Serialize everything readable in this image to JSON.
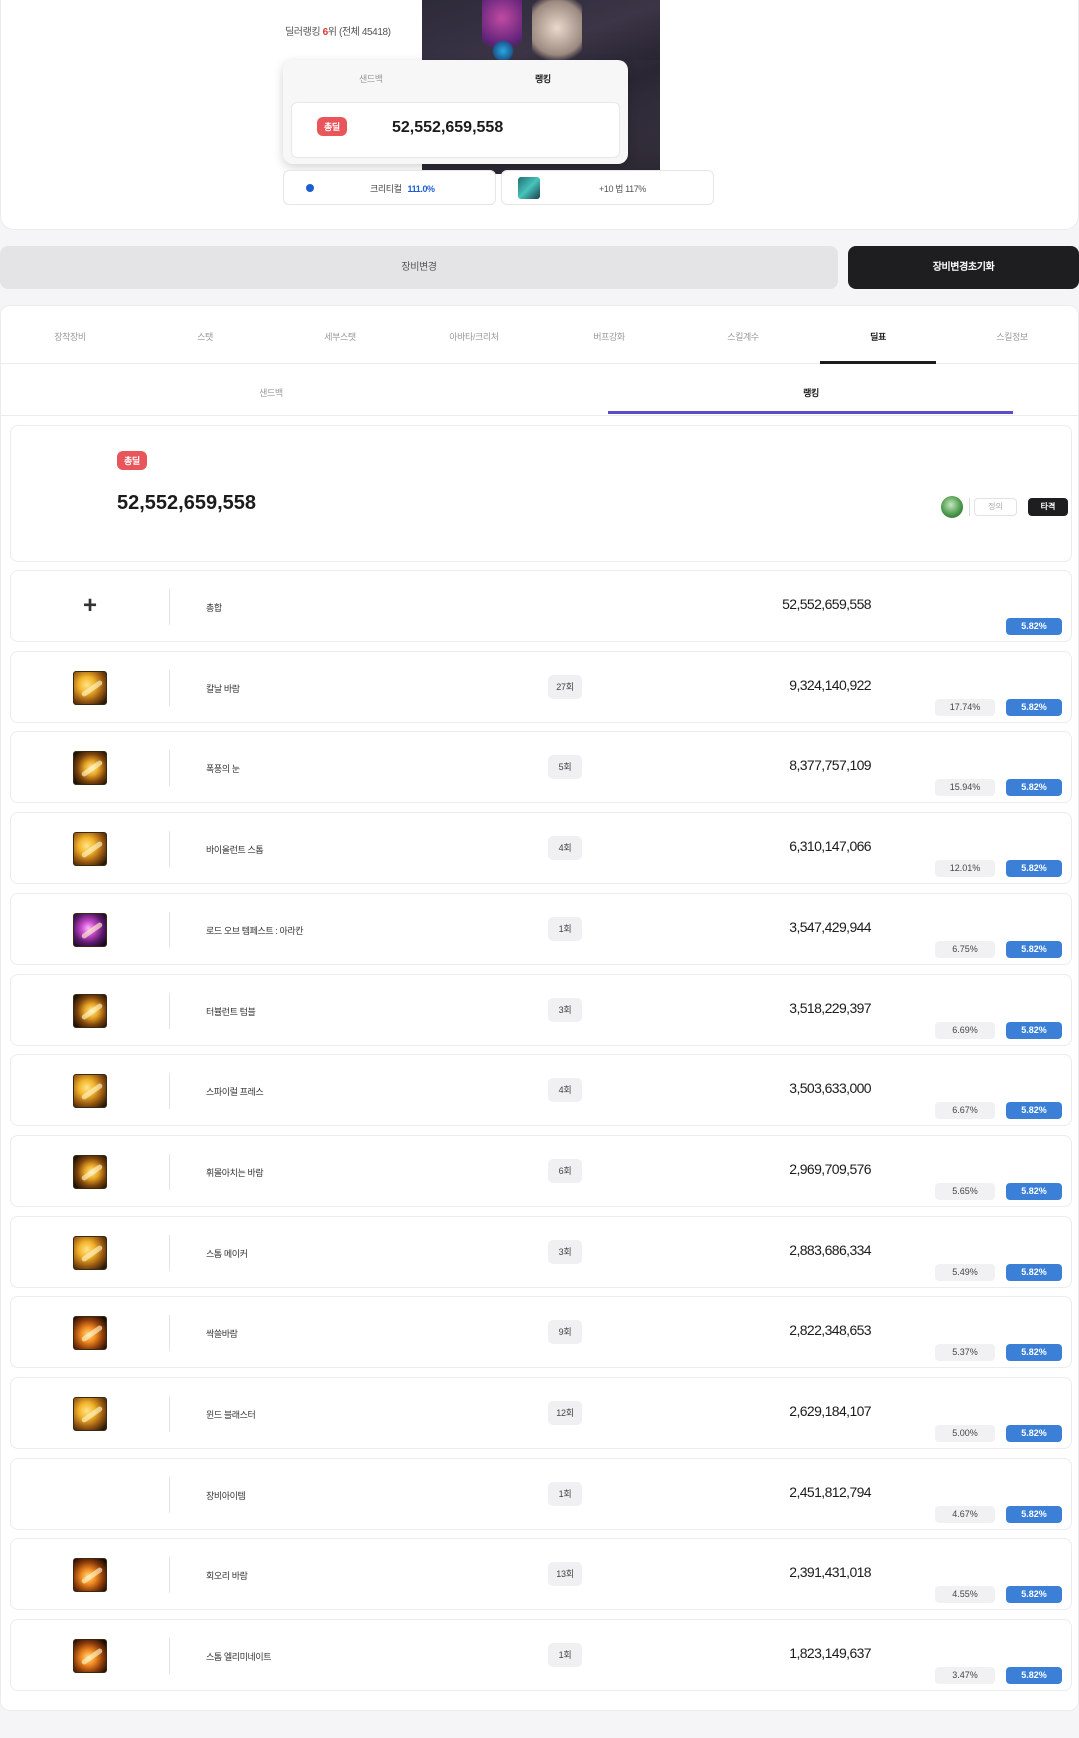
{
  "profile": {
    "dealer_rank_prefix": "딜러랭킹",
    "dealer_rank_num": "6",
    "dealer_rank_suffix": "위 (전체 45418)",
    "panel_tabs": [
      "샌드백",
      "랭킹"
    ],
    "total_badge": "총딜",
    "total_damage": "52,552,659,558"
  },
  "stats": {
    "crit_label": "크리티컬",
    "crit_value": "111.0%",
    "item_label": "+10 법 117%"
  },
  "actions": {
    "change_label": "장비변경",
    "reset_label": "장비변경초기화"
  },
  "main_tabs": [
    "장착장비",
    "스탯",
    "세부스탯",
    "아바타/크리처",
    "버프강화",
    "스킬계수",
    "딜표",
    "스킬정보"
  ],
  "sub_tabs": [
    "샌드백",
    "랭킹"
  ],
  "summary": {
    "badge": "총딜",
    "total": "52,552,659,558",
    "hold_label": "정의",
    "hit_label": "타격"
  },
  "rows": [
    {
      "icon": "plus-icon",
      "name": "총합",
      "hits": "",
      "damage": "52,552,659,558",
      "pct": "",
      "pct_blue": "5.82%"
    },
    {
      "icon": "blade-wind-skill-icon",
      "name": "칼날 바람",
      "hits": "27회",
      "damage": "9,324,140,922",
      "pct": "17.74%",
      "pct_blue": "5.82%"
    },
    {
      "icon": "storm-eye-skill-icon",
      "name": "폭풍의 눈",
      "hits": "5회",
      "damage": "8,377,757,109",
      "pct": "15.94%",
      "pct_blue": "5.82%"
    },
    {
      "icon": "violent-storm-skill-icon",
      "name": "바이올런트 스톰",
      "hits": "4회",
      "damage": "6,310,147,066",
      "pct": "12.01%",
      "pct_blue": "5.82%"
    },
    {
      "icon": "lord-of-tempest-skill-icon",
      "name": "로드 오브 템페스트 : 아라칸",
      "hits": "1회",
      "damage": "3,547,429,944",
      "pct": "6.75%",
      "pct_blue": "5.82%"
    },
    {
      "icon": "turbulent-tumble-skill-icon",
      "name": "터뷸런트 텀블",
      "hits": "3회",
      "damage": "3,518,229,397",
      "pct": "6.69%",
      "pct_blue": "5.82%"
    },
    {
      "icon": "spiral-press-skill-icon",
      "name": "스파이럴 프레스",
      "hits": "4회",
      "damage": "3,503,633,000",
      "pct": "6.67%",
      "pct_blue": "5.82%"
    },
    {
      "icon": "sweeping-wind-skill-icon",
      "name": "휘몰아치는 바람",
      "hits": "6회",
      "damage": "2,969,709,576",
      "pct": "5.65%",
      "pct_blue": "5.82%"
    },
    {
      "icon": "storm-maker-skill-icon",
      "name": "스톰 메이커",
      "hits": "3회",
      "damage": "2,883,686,334",
      "pct": "5.49%",
      "pct_blue": "5.82%"
    },
    {
      "icon": "cold-wind-skill-icon",
      "name": "싹쓸바람",
      "hits": "9회",
      "damage": "2,822,348,653",
      "pct": "5.37%",
      "pct_blue": "5.82%"
    },
    {
      "icon": "wind-blaster-skill-icon",
      "name": "윈드 블래스터",
      "hits": "12회",
      "damage": "2,629,184,107",
      "pct": "5.00%",
      "pct_blue": "5.82%"
    },
    {
      "icon": "",
      "name": "장비아이템",
      "hits": "1회",
      "damage": "2,451,812,794",
      "pct": "4.67%",
      "pct_blue": "5.82%"
    },
    {
      "icon": "whirlwind-skill-icon",
      "name": "회오리 바람",
      "hits": "13회",
      "damage": "2,391,431,018",
      "pct": "4.55%",
      "pct_blue": "5.82%"
    },
    {
      "icon": "storm-eliminate-skill-icon",
      "name": "스톰 엘리미네이트",
      "hits": "1회",
      "damage": "1,823,149,637",
      "pct": "3.47%",
      "pct_blue": "5.82%"
    }
  ]
}
